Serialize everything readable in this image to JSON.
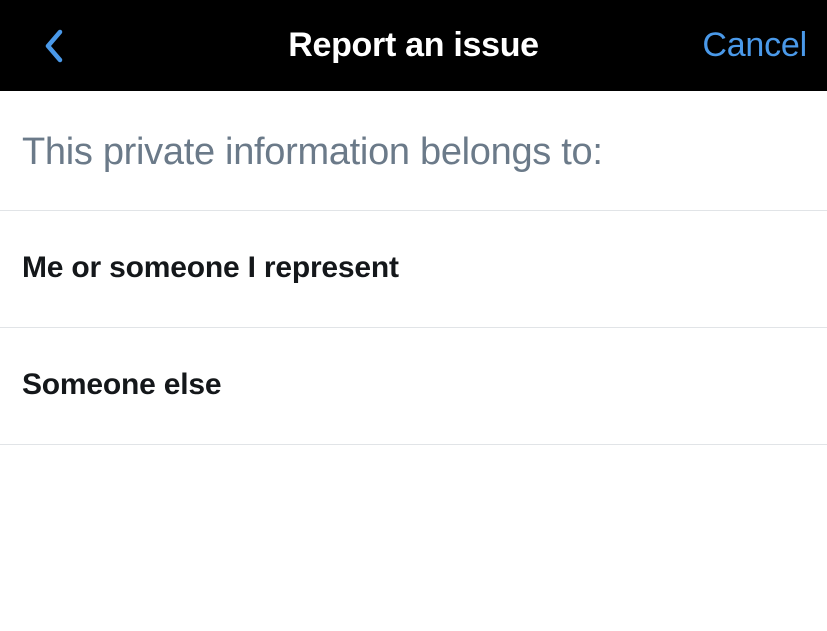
{
  "navbar": {
    "title": "Report an issue",
    "cancel_label": "Cancel"
  },
  "prompt": "This private information belongs to:",
  "options": [
    {
      "label": "Me or someone I represent"
    },
    {
      "label": "Someone else"
    }
  ],
  "colors": {
    "accent": "#4a99e9",
    "navbar_bg": "#000000",
    "prompt_text": "#6b7a89",
    "option_text": "#14171a",
    "divider": "#e1e4e7"
  }
}
